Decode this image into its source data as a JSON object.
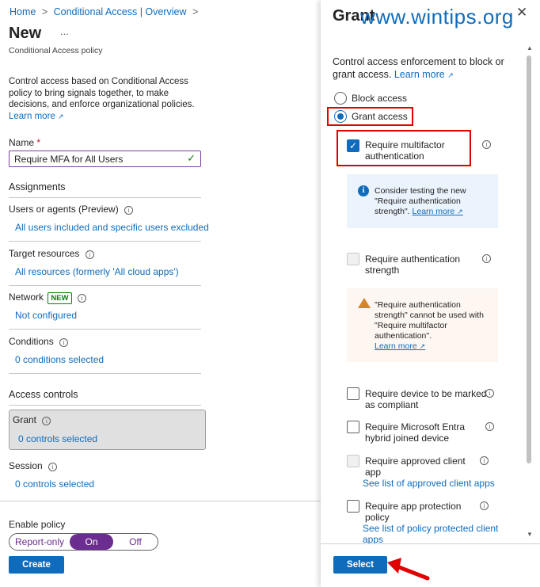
{
  "breadcrumb": {
    "home": "Home",
    "sep1": ">",
    "section": "Conditional Access | Overview",
    "sep2": ">"
  },
  "page": {
    "title": "New",
    "more": "...",
    "subtitle": "Conditional Access policy",
    "description": "Control access based on Conditional Access policy to bring signals together, to make decisions, and enforce organizational policies.",
    "learn_more": "Learn more"
  },
  "name_field": {
    "label": "Name",
    "required": "*",
    "value": "Require MFA for All Users"
  },
  "assignments": {
    "heading": "Assignments",
    "users": {
      "label": "Users or agents (Preview)",
      "value": "All users included and specific users excluded"
    },
    "targets": {
      "label": "Target resources",
      "value": "All resources (formerly 'All cloud apps')"
    },
    "network": {
      "label": "Network",
      "badge": "NEW",
      "value": "Not configured"
    },
    "conditions": {
      "label": "Conditions",
      "value": "0 conditions selected"
    }
  },
  "access_controls": {
    "heading": "Access controls",
    "grant": {
      "label": "Grant",
      "value": "0 controls selected"
    },
    "session": {
      "label": "Session",
      "value": "0 controls selected"
    }
  },
  "enable_policy": {
    "label": "Enable policy",
    "options": [
      "Report-only",
      "On",
      "Off"
    ],
    "selected": "On"
  },
  "create_button": "Create",
  "watermark": "www.wintips.org",
  "grant_panel": {
    "title": "Grant",
    "description": "Control access enforcement to block or grant access.",
    "learn_more": "Learn more",
    "block_access": "Block access",
    "grant_access": "Grant access",
    "selected_access": "Grant access",
    "mfa": {
      "label_line1": "Require multifactor",
      "label_line2": "authentication",
      "checked": true
    },
    "info_box": {
      "line1": "Consider testing the new",
      "line2": "\"Require authentication",
      "line3": "strength\".",
      "learn_more": "Learn more"
    },
    "auth_strength": {
      "label_line1": "Require authentication",
      "label_line2": "strength"
    },
    "warning_box": {
      "line1": "\"Require authentication",
      "line2": "strength\" cannot be used with",
      "line3": "\"Require multifactor",
      "line4": "authentication\".",
      "learn_more": "Learn more"
    },
    "compliant": {
      "label_line1": "Require device to be marked",
      "label_line2": "as compliant"
    },
    "hybrid": {
      "label_line1": "Require Microsoft Entra",
      "label_line2": "hybrid joined device"
    },
    "approved_app": {
      "label_line1": "Require approved client",
      "label_line2": "app",
      "link": "See list of approved client apps"
    },
    "protection": {
      "label_line1": "Require app protection",
      "label_line2": "policy",
      "link_line1": "See list of policy protected client",
      "link_line2": "apps"
    },
    "select_button": "Select"
  },
  "colors": {
    "accent": "#0f6cbd",
    "purple": "#6b2d8f",
    "highlight_red": "#e00000",
    "new_badge": "#107c10"
  }
}
